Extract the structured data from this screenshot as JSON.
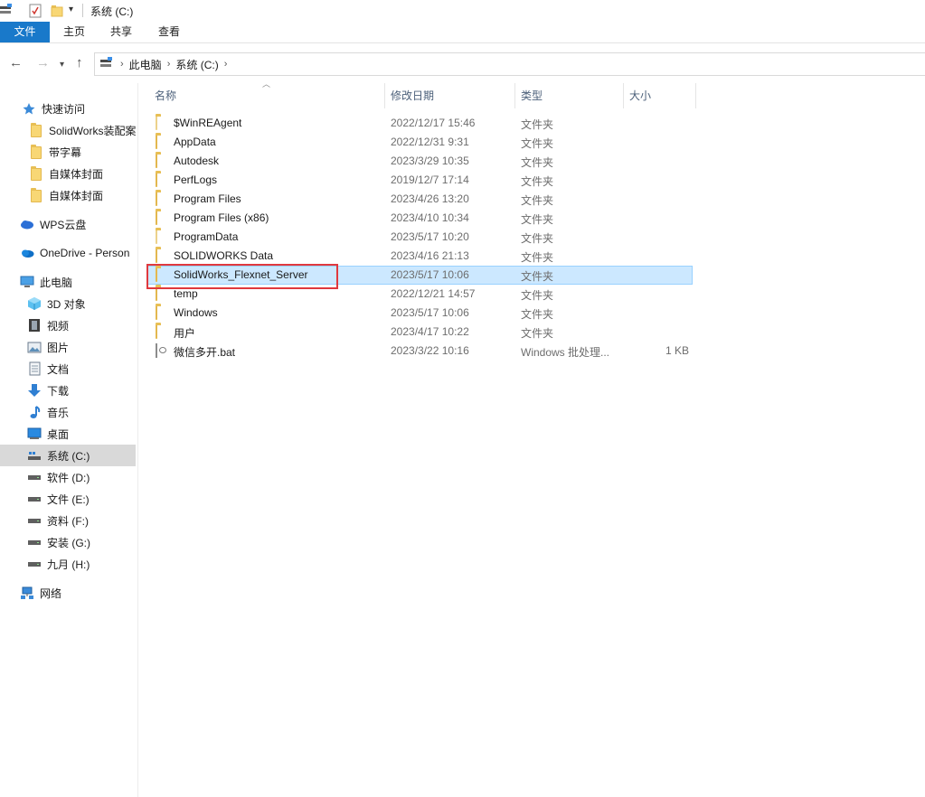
{
  "window": {
    "title": "系统 (C:)"
  },
  "ribbon": {
    "tabs": [
      "文件",
      "主页",
      "共享",
      "查看"
    ]
  },
  "address": {
    "crumbs": [
      "此电脑",
      "系统 (C:)"
    ]
  },
  "nav": {
    "quick_access": "快速访问",
    "pinned": [
      "SolidWorks装配案",
      "带字幕",
      "自媒体封面",
      "自媒体封面"
    ],
    "wps": "WPS云盘",
    "onedrive": "OneDrive - Person",
    "this_pc": "此电脑",
    "pc_items": [
      "3D 对象",
      "视频",
      "图片",
      "文档",
      "下载",
      "音乐",
      "桌面",
      "系统 (C:)",
      "软件 (D:)",
      "文件 (E:)",
      "资料 (F:)",
      "安装 (G:)",
      "九月 (H:)"
    ],
    "network": "网络"
  },
  "columns": {
    "name": "名称",
    "date": "修改日期",
    "type": "类型",
    "size": "大小"
  },
  "files": [
    {
      "name": "$WinREAgent",
      "date": "2022/12/17 15:46",
      "type": "文件夹",
      "size": ""
    },
    {
      "name": "AppData",
      "date": "2022/12/31 9:31",
      "type": "文件夹",
      "size": ""
    },
    {
      "name": "Autodesk",
      "date": "2023/3/29 10:35",
      "type": "文件夹",
      "size": ""
    },
    {
      "name": "PerfLogs",
      "date": "2019/12/7 17:14",
      "type": "文件夹",
      "size": ""
    },
    {
      "name": "Program Files",
      "date": "2023/4/26 13:20",
      "type": "文件夹",
      "size": ""
    },
    {
      "name": "Program Files (x86)",
      "date": "2023/4/10 10:34",
      "type": "文件夹",
      "size": ""
    },
    {
      "name": "ProgramData",
      "date": "2023/5/17 10:20",
      "type": "文件夹",
      "size": ""
    },
    {
      "name": "SOLIDWORKS Data",
      "date": "2023/4/16 21:13",
      "type": "文件夹",
      "size": ""
    },
    {
      "name": "SolidWorks_Flexnet_Server",
      "date": "2023/5/17 10:06",
      "type": "文件夹",
      "size": ""
    },
    {
      "name": "temp",
      "date": "2022/12/21 14:57",
      "type": "文件夹",
      "size": ""
    },
    {
      "name": "Windows",
      "date": "2023/5/17 10:06",
      "type": "文件夹",
      "size": ""
    },
    {
      "name": "用户",
      "date": "2023/4/17 10:22",
      "type": "文件夹",
      "size": ""
    },
    {
      "name": "微信多开.bat",
      "date": "2023/3/22 10:16",
      "type": "Windows 批处理...",
      "size": "1 KB"
    }
  ]
}
